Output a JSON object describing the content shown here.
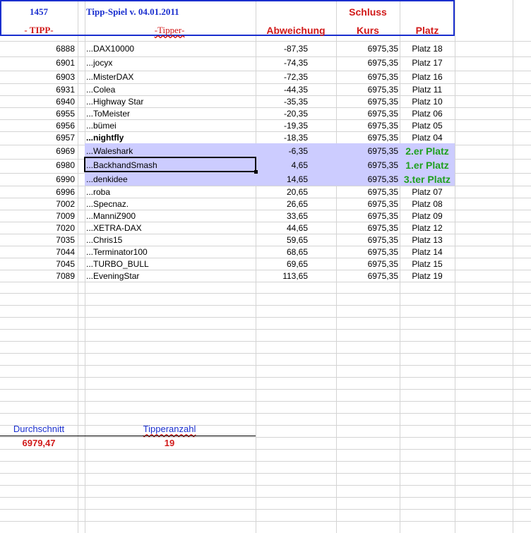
{
  "header": {
    "count": "1457",
    "title": "Tipp-Spiel v. 04.01.2011",
    "schluss": "Schluss",
    "tipp": "- TIPP-",
    "tipper": "-Tipper-",
    "abweichung": "Abweichung",
    "kurs": "Kurs",
    "platz": "Platz"
  },
  "rows": [
    {
      "tipp": "6888",
      "name": "...DAX10000",
      "abw": "-87,35",
      "kurs": "6975,35",
      "platz": "Platz 18"
    },
    {
      "tipp": "6901",
      "name": "...jocyx",
      "abw": "-74,35",
      "kurs": "6975,35",
      "platz": "Platz 17"
    },
    {
      "tipp": "6903",
      "name": "...MisterDAX",
      "abw": "-72,35",
      "kurs": "6975,35",
      "platz": "Platz 16"
    },
    {
      "tipp": "6931",
      "name": "...Colea",
      "abw": "-44,35",
      "kurs": "6975,35",
      "platz": "Platz 11"
    },
    {
      "tipp": "6940",
      "name": "...Highway Star",
      "abw": "-35,35",
      "kurs": "6975,35",
      "platz": "Platz 10"
    },
    {
      "tipp": "6955",
      "name": "...ToMeister",
      "abw": "-20,35",
      "kurs": "6975,35",
      "platz": "Platz 06"
    },
    {
      "tipp": "6956",
      "name": "...bümei",
      "abw": "-19,35",
      "kurs": "6975,35",
      "platz": "Platz 05"
    },
    {
      "tipp": "6957",
      "name": "...nightfly",
      "abw": "-18,35",
      "kurs": "6975,35",
      "platz": "Platz 04"
    },
    {
      "tipp": "6969",
      "name": "...Waleshark",
      "abw": "-6,35",
      "kurs": "6975,35",
      "platz": "2.er Platz"
    },
    {
      "tipp": "6980",
      "name": "...BackhandSmash",
      "abw": "4,65",
      "kurs": "6975,35",
      "platz": "1.er Platz"
    },
    {
      "tipp": "6990",
      "name": "...denkidee",
      "abw": "14,65",
      "kurs": "6975,35",
      "platz": "3.ter Platz"
    },
    {
      "tipp": "6996",
      "name": "...roba",
      "abw": "20,65",
      "kurs": "6975,35",
      "platz": "Platz 07"
    },
    {
      "tipp": "7002",
      "name": "...Specnaz.",
      "abw": "26,65",
      "kurs": "6975,35",
      "platz": "Platz 08"
    },
    {
      "tipp": "7009",
      "name": "...ManniZ900",
      "abw": "33,65",
      "kurs": "6975,35",
      "platz": "Platz 09"
    },
    {
      "tipp": "7020",
      "name": "...XETRA-DAX",
      "abw": "44,65",
      "kurs": "6975,35",
      "platz": "Platz 12"
    },
    {
      "tipp": "7035",
      "name": "...Chris15",
      "abw": "59,65",
      "kurs": "6975,35",
      "platz": "Platz 13"
    },
    {
      "tipp": "7044",
      "name": "...Terminator100",
      "abw": "68,65",
      "kurs": "6975,35",
      "platz": "Platz 14"
    },
    {
      "tipp": "7045",
      "name": "...TURBO_BULL",
      "abw": "69,65",
      "kurs": "6975,35",
      "platz": "Platz 15"
    },
    {
      "tipp": "7089",
      "name": "...EveningStar",
      "abw": "113,65",
      "kurs": "6975,35",
      "platz": "Platz 19"
    }
  ],
  "summary": {
    "durchschnitt_label": "Durchschnitt",
    "durchschnitt_value": "6979,47",
    "tipperanzahl_label": "Tipperanzahl",
    "tipperanzahl_value": "19"
  },
  "colors": {
    "header_blue": "#1a2fcf",
    "header_red": "#d11a1a",
    "winner_green": "#1fa01f",
    "highlight_band": "#ccccff"
  }
}
